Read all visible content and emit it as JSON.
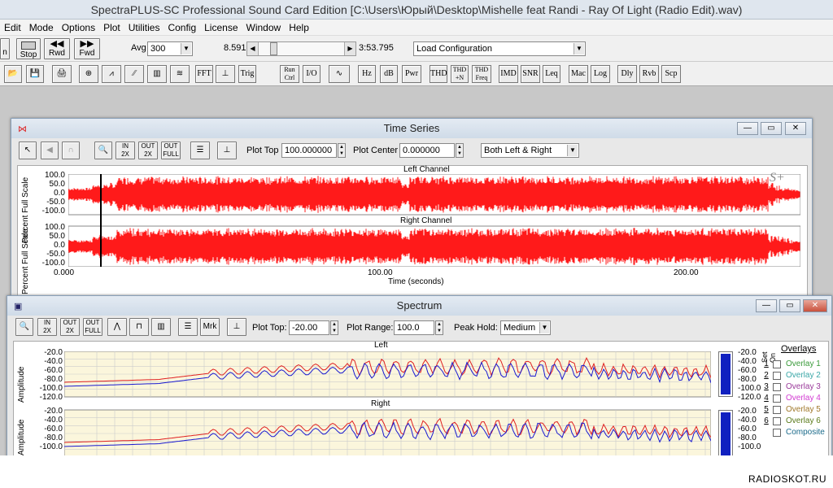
{
  "app": {
    "title": "SpectraPLUS-SC Professional Sound Card Edition [C:\\Users\\Юрый\\Desktop\\Mishelle feat Randi - Ray Of Light (Radio Edit).wav)",
    "menu": [
      "Edit",
      "Mode",
      "Options",
      "Plot",
      "Utilities",
      "Config",
      "License",
      "Window",
      "Help"
    ]
  },
  "toolbar": {
    "partial_btn": "n",
    "stop": "Stop",
    "rwd": "Rwd",
    "fwd": "Fwd",
    "avg_label": "Avg",
    "avg_value": "300",
    "position_value": "8.591",
    "duration_value": "3:53.795",
    "config_select": "Load Configuration",
    "buttons2": [
      "FFT",
      "Trig",
      "Run Ctrl",
      "I/O",
      "Hz",
      "dB",
      "Pwr",
      "THD",
      "THD +N",
      "THD Freq",
      "IMD",
      "SNR",
      "Leq",
      "Mac",
      "Log",
      "Dly",
      "Rvb",
      "Scp"
    ]
  },
  "time_series": {
    "title": "Time Series",
    "plot_top_label": "Plot Top",
    "plot_top_value": "100.000000",
    "plot_center_label": "Plot Center",
    "plot_center_value": "0.000000",
    "channel_select": "Both Left & Right",
    "left_label": "Left Channel",
    "right_label": "Right Channel",
    "y_ticks": [
      "100.0",
      "50.0",
      "0.0",
      "-50.0",
      "-100.0"
    ],
    "x_ticks": [
      "0.000",
      "100.00",
      "200.00"
    ],
    "x_axis": "Time (seconds)",
    "y_axis_left": "Percent Full Scale",
    "y_axis_right": "Percent Full Scale",
    "watermark": "S+"
  },
  "spectrum": {
    "title": "Spectrum",
    "plot_top_label": "Plot Top:",
    "plot_top_value": "-20.00",
    "plot_range_label": "Plot Range:",
    "plot_range_value": "100.0",
    "peak_hold_label": "Peak Hold:",
    "peak_hold_value": "Medium",
    "left_label": "Left",
    "right_label": "Right",
    "y_ticks": [
      "-20.0",
      "-40.0",
      "-60.0",
      "-80.0",
      "-100.0",
      "-120.0"
    ],
    "y_axis_left": "Amplitude",
    "y_axis_right": "Amplitude",
    "mrk": "Mrk",
    "overlays_title": "Overlays",
    "set_label": "Set",
    "on_label": "On",
    "overlays": [
      {
        "num": "1",
        "name": "Overlay 1",
        "color": "#3a9a3a"
      },
      {
        "num": "2",
        "name": "Overlay 2",
        "color": "#3aa7a7"
      },
      {
        "num": "3",
        "name": "Overlay 3",
        "color": "#9a3a9a"
      },
      {
        "num": "4",
        "name": "Overlay 4",
        "color": "#d23ad2"
      },
      {
        "num": "5",
        "name": "Overlay 5",
        "color": "#a0782a"
      },
      {
        "num": "6",
        "name": "Overlay 6",
        "color": "#5a7a1a"
      },
      {
        "num": "",
        "name": "Composite",
        "color": "#1a6a8a"
      }
    ]
  },
  "footer": {
    "watermark": "RADIOSKOT.RU"
  },
  "colors": {
    "waveform": "#ff1a1a",
    "spectrum_red": "#e02020",
    "spectrum_blue": "#1a1ad0",
    "meter": "#1020c0"
  }
}
